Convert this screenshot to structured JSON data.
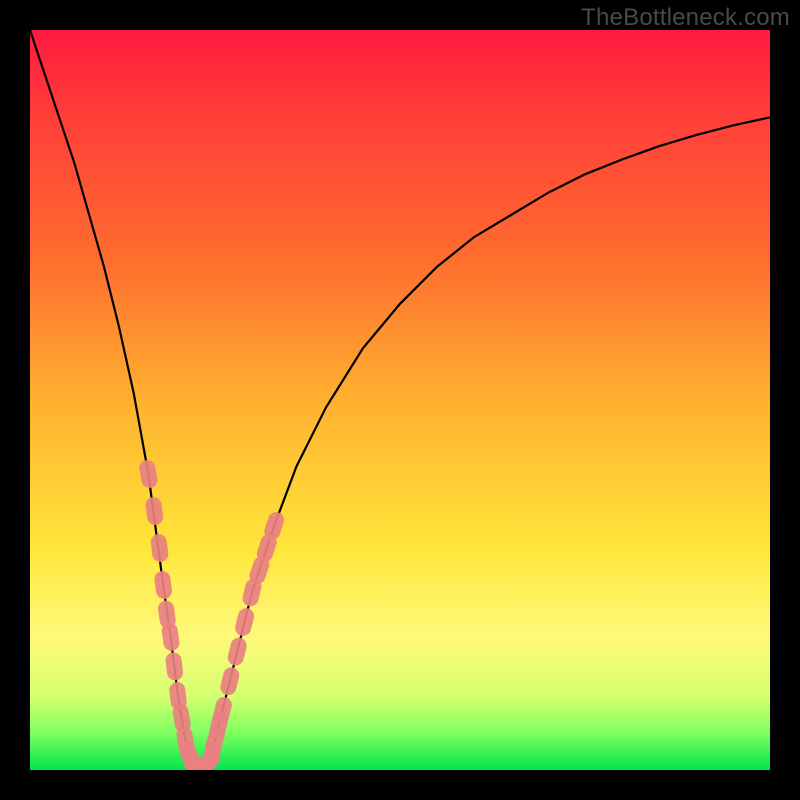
{
  "watermark": "TheBottleneck.com",
  "chart_data": {
    "type": "line",
    "title": "",
    "xlabel": "",
    "ylabel": "",
    "xlim": [
      0,
      100
    ],
    "ylim": [
      0,
      100
    ],
    "series": [
      {
        "name": "bottleneck-curve",
        "x": [
          0,
          2,
          4,
          6,
          8,
          10,
          12,
          14,
          16,
          18,
          19,
          20,
          21,
          22,
          23,
          24,
          25,
          26,
          28,
          30,
          33,
          36,
          40,
          45,
          50,
          55,
          60,
          65,
          70,
          75,
          80,
          85,
          90,
          95,
          100
        ],
        "values": [
          100,
          94,
          88,
          82,
          75,
          68,
          60,
          51,
          40,
          25,
          18,
          10,
          4,
          1,
          0,
          1,
          4,
          8,
          16,
          24,
          33,
          41,
          49,
          57,
          63,
          68,
          72,
          75,
          78,
          80.5,
          82.5,
          84.3,
          85.8,
          87.1,
          88.2
        ]
      }
    ],
    "markers": {
      "name": "highlighted-points",
      "color": "#e98082",
      "points": [
        {
          "x": 16.0,
          "y": 40
        },
        {
          "x": 16.8,
          "y": 35
        },
        {
          "x": 17.5,
          "y": 30
        },
        {
          "x": 18.0,
          "y": 25
        },
        {
          "x": 18.5,
          "y": 21
        },
        {
          "x": 19.0,
          "y": 18
        },
        {
          "x": 19.5,
          "y": 14
        },
        {
          "x": 20.0,
          "y": 10
        },
        {
          "x": 20.5,
          "y": 7
        },
        {
          "x": 21.0,
          "y": 4
        },
        {
          "x": 21.5,
          "y": 2
        },
        {
          "x": 22.0,
          "y": 1
        },
        {
          "x": 22.5,
          "y": 0.3
        },
        {
          "x": 23.0,
          "y": 0
        },
        {
          "x": 23.5,
          "y": 0.3
        },
        {
          "x": 24.0,
          "y": 1
        },
        {
          "x": 24.5,
          "y": 2
        },
        {
          "x": 25.0,
          "y": 4
        },
        {
          "x": 25.5,
          "y": 6
        },
        {
          "x": 26.0,
          "y": 8
        },
        {
          "x": 27.0,
          "y": 12
        },
        {
          "x": 28.0,
          "y": 16
        },
        {
          "x": 29.0,
          "y": 20
        },
        {
          "x": 30.0,
          "y": 24
        },
        {
          "x": 31.0,
          "y": 27
        },
        {
          "x": 32.0,
          "y": 30
        },
        {
          "x": 33.0,
          "y": 33
        }
      ]
    }
  }
}
